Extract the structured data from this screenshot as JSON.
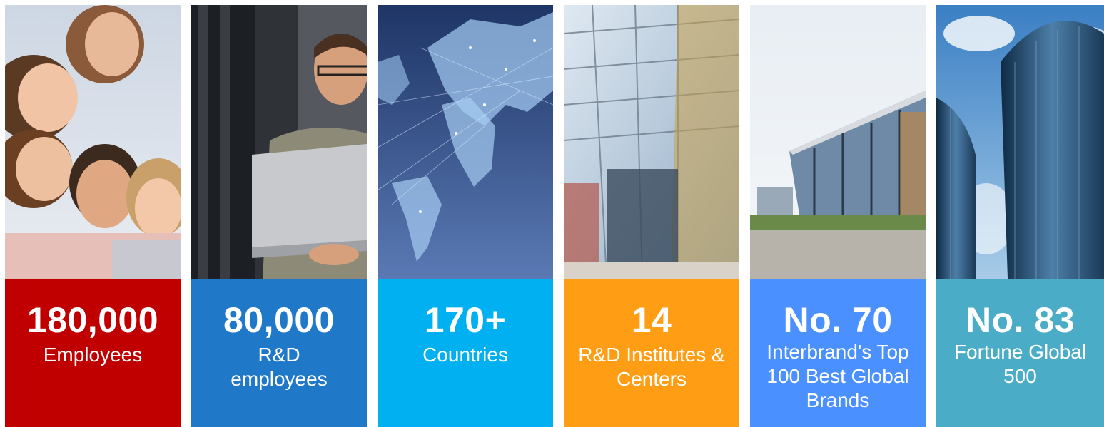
{
  "colors": {
    "employees": "#c00000",
    "rd_employees": "#1f78c8",
    "countries": "#00b0f0",
    "institutes": "#ff9e14",
    "brands": "#4a90ff",
    "fortune": "#4aacc6"
  },
  "cards": [
    {
      "stat": "180,000",
      "label": "Employees",
      "image": "group-of-smiling-people"
    },
    {
      "stat": "80,000",
      "label": "R&D\nemployees",
      "image": "engineer-with-laptop-in-server-room"
    },
    {
      "stat": "170+",
      "label": "Countries",
      "image": "glowing-world-map-network"
    },
    {
      "stat": "14",
      "label": "R&D Institutes &\nCenters",
      "image": "glass-atrium-building"
    },
    {
      "stat": "No. 70",
      "label": "Interbrand's Top\n100 Best Global\nBrands",
      "image": "modern-office-building"
    },
    {
      "stat": "No. 83",
      "label": "Fortune Global\n500",
      "image": "glass-skyscraper-towers"
    }
  ]
}
